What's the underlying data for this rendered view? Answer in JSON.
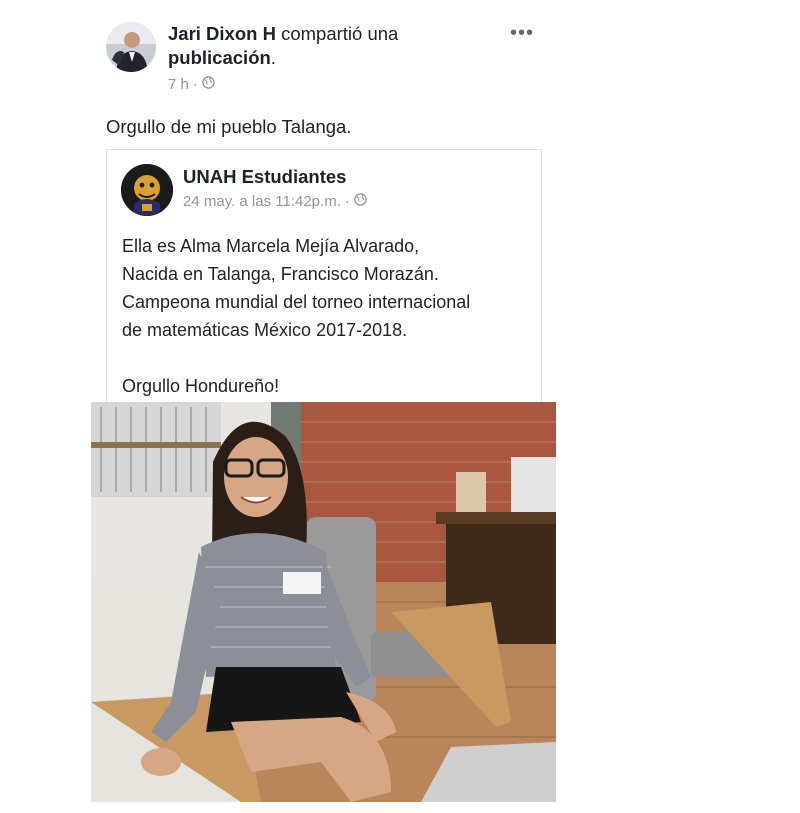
{
  "post": {
    "author": "Jari Dixon H",
    "action": "compartió una",
    "object": "publicación",
    "period": ".",
    "time": "7 h",
    "dot": "·",
    "more_icon": "more-horizontal-icon",
    "text": "Orgullo de mi pueblo Talanga."
  },
  "shared": {
    "page_name": "UNAH Estudiantes",
    "date": "24 may. a las 11:42p.m.",
    "dot": "·",
    "body_lines": [
      "Ella es Alma Marcela Mejía Alvarado,",
      "Nacida en Talanga, Francisco Morazán.",
      "Campeona mundial del torneo internacional",
      "de matemáticas México 2017-2018."
    ],
    "closing": "Orgullo Hondureño!"
  },
  "colors": {
    "text": "#1d2129",
    "meta": "#90949c",
    "border": "#dddfe2"
  }
}
